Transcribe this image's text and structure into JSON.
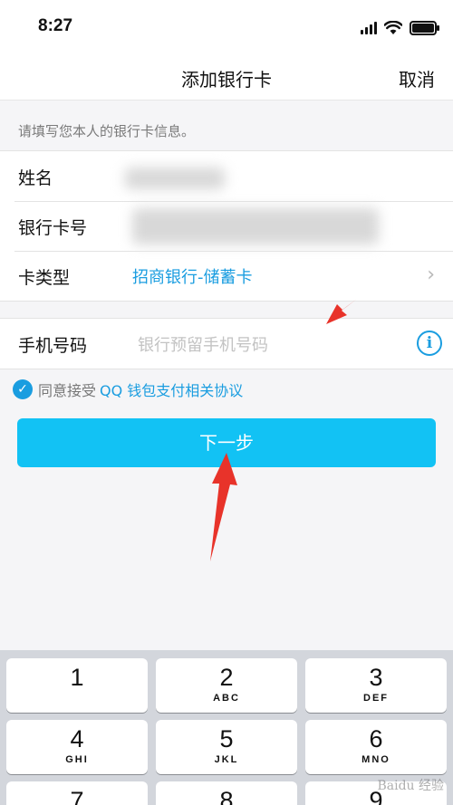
{
  "status_bar": {
    "time": "8:27"
  },
  "nav": {
    "title": "添加银行卡",
    "cancel_label": "取消"
  },
  "hint": "请填写您本人的银行卡信息。",
  "form": {
    "name_label": "姓名",
    "card_number_label": "银行卡号",
    "card_type_label": "卡类型",
    "card_type_value": "招商银行-储蓄卡",
    "phone_label": "手机号码",
    "phone_placeholder": "银行预留手机号码"
  },
  "agreement": {
    "prefix": "同意接受",
    "link": "QQ 钱包支付相关协议"
  },
  "next_button": "下一步",
  "keyboard": {
    "keys": [
      {
        "num": "1",
        "letters": ""
      },
      {
        "num": "2",
        "letters": "ABC"
      },
      {
        "num": "3",
        "letters": "DEF"
      },
      {
        "num": "4",
        "letters": "GHI"
      },
      {
        "num": "5",
        "letters": "JKL"
      },
      {
        "num": "6",
        "letters": "MNO"
      },
      {
        "num": "7",
        "letters": ""
      },
      {
        "num": "8",
        "letters": ""
      },
      {
        "num": "9",
        "letters": ""
      }
    ]
  },
  "colors": {
    "accent": "#1a9de0",
    "button": "#12c2f4",
    "annotation_arrow": "#e8332a"
  },
  "watermark": "Baidu 经验"
}
